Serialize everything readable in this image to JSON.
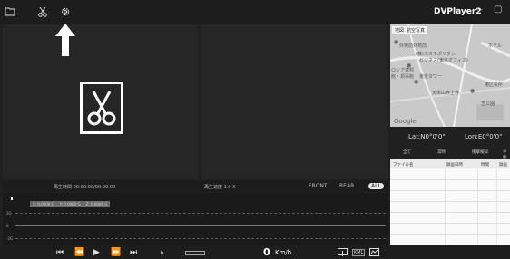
{
  "app": {
    "title": "DVPlayer2"
  },
  "toolbar": {
    "folder_icon": "folder-icon",
    "cut_icon": "scissors-icon",
    "settings_icon": "gear-icon"
  },
  "window_controls": {
    "minimize": "—",
    "maximize": "▢"
  },
  "info_bar": {
    "playback_time": "再生時間 00:00:00/00:00:00",
    "playback_speed": "再生速度 1.0 X",
    "cameras": [
      "FRONT",
      "REAR",
      "ALL"
    ],
    "active_camera": "ALL"
  },
  "timeline": {
    "sensor_tags": [
      "X: 0.0000 G",
      "Y: 0.0000 G",
      "Z: 0.0000 G"
    ],
    "y_labels": [
      "2G",
      "0",
      "-2G"
    ]
  },
  "controls": {
    "speed_value": "0",
    "speed_unit": "Km/h",
    "kml_label": "KML"
  },
  "map": {
    "tabs": [
      "地図",
      "航空写真"
    ],
    "labels": [
      "外苑前外苑前",
      "(株)コスモポリタン",
      "ビジネス(東京オフィス)",
      "ロシア連邦",
      "館・領事館",
      "東京タワー",
      "港区役所",
      "天米山寺上寺",
      "芝公園",
      "ホテル"
    ],
    "logo": "Google"
  },
  "gps": {
    "lat": "Lat:N0°0'0\"",
    "lon": "Lon:E0°0'0\""
  },
  "file_list": {
    "filters": [
      "全て",
      "常時",
      "衝撃検知",
      "手動"
    ],
    "columns": [
      "ファイル名",
      "録画日時",
      "時間",
      "録画"
    ]
  }
}
